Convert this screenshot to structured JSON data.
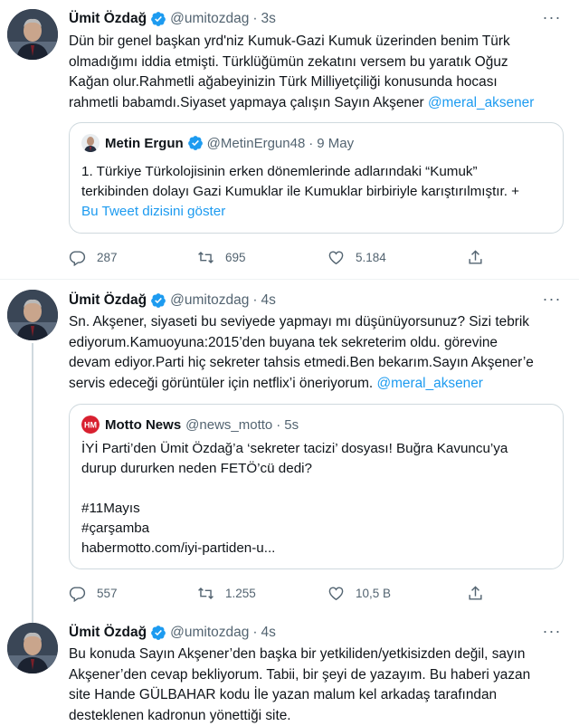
{
  "tweets": [
    {
      "name": "Ümit Özdağ",
      "handle": "@umitozdag",
      "time": "3s",
      "lines": [
        "Dün bir genel başkan yrd'niz Kumuk-Gazi Kumuk üzerinden benim Türk",
        "olmadığımı iddia etmişti. Türklüğümün zekatını versem bu yaratık Oğuz",
        "Kağan olur.Rahmetli ağabeyinizin Türk Milliyetçiliği konusunda hocası",
        "rahmetli babamdı.Siyaset yapmaya çalışın Sayın Akşener "
      ],
      "mention": "@meral_aksener",
      "quote": {
        "name": "Metin Ergun",
        "handle": "@MetinErgun48",
        "time": "9 May",
        "lines": [
          "1. Türkiye Türkolojisinin erken dönemlerinde adlarındaki “Kumuk”",
          "terkibinden dolayı Gazi Kumuklar ile Kumuklar birbiriyle karıştırılmıştır. +"
        ],
        "link": "Bu Tweet dizisini göster"
      },
      "stats": {
        "replies": "287",
        "retweets": "695",
        "likes": "5.184"
      }
    },
    {
      "name": "Ümit Özdağ",
      "handle": "@umitozdag",
      "time": "4s",
      "lines": [
        "Sn. Akşener, siyaseti bu seviyede yapmayı mı düşünüyorsunuz? Sizi tebrik",
        "ediyorum.Kamuoyuna:2015’den buyana tek sekreterim oldu. görevine",
        "devam ediyor.Parti hiç sekreter tahsis etmedi.Ben bekarım.Sayın Akşener’e",
        "servis edeceği görüntüler için netflix’i öneriyorum. "
      ],
      "mention": "@meral_aksener",
      "quote": {
        "name": "Motto News",
        "handle": "@news_motto",
        "time": "5s",
        "lines": [
          "İYİ Parti’den Ümit Özdağ’a ‘sekreter tacizi’ dosyası! Buğra Kavuncu’ya",
          "durup dururken neden FETÖ’cü dedi?",
          "",
          "#11Mayıs",
          "#çarşamba",
          "habermotto.com/iyi-partiden-u..."
        ]
      },
      "stats": {
        "replies": "557",
        "retweets": "1.255",
        "likes": "10,5 B"
      }
    },
    {
      "name": "Ümit Özdağ",
      "handle": "@umitozdag",
      "time": "4s",
      "lines": [
        "Bu konuda Sayın Akşener’den başka bir yetkiliden/yetkisizden değil, sayın",
        "Akşener’den cevap bekliyorum. Tabii, bir şeyi de yazayım. Bu haberi yazan",
        "site Hande GÜLBAHAR kodu İle yazan malum kel arkadaş tarafından",
        "desteklenen kadronun yönettiği site."
      ]
    }
  ],
  "colors": {
    "accent": "#1d9bf0",
    "muted": "#536471",
    "text": "#0f1419",
    "border": "#cfd9de"
  },
  "icons": {
    "more": "more-dots-icon",
    "reply": "reply-icon",
    "retweet": "retweet-icon",
    "like": "heart-icon",
    "share": "share-icon",
    "verified": "verified-badge-icon"
  }
}
